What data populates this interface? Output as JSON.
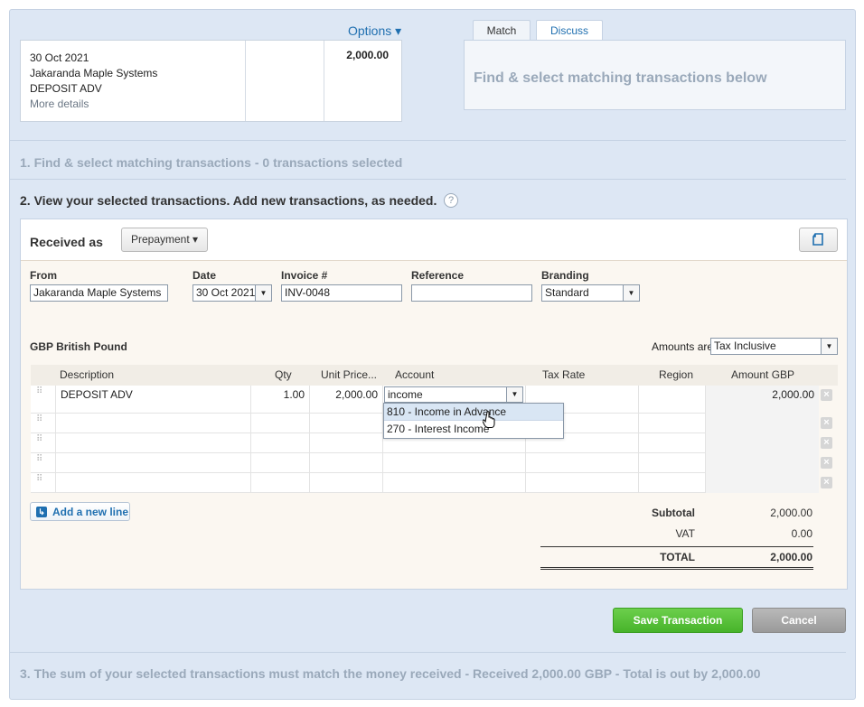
{
  "statement": {
    "date": "30 Oct 2021",
    "payee": "Jakaranda Maple Systems",
    "description": "DEPOSIT ADV",
    "more_details": "More details",
    "amount": "2,000.00",
    "options_label": "Options ▾"
  },
  "tabs": {
    "match": "Match",
    "discuss": "Discuss"
  },
  "match_panel_text": "Find & select matching transactions below",
  "steps": {
    "step1": "1. Find & select matching transactions - 0 transactions selected",
    "step2": "2. View your selected transactions. Add new transactions, as needed.",
    "step2_help": "?",
    "step3": "3. The sum of your selected transactions must match the money received - Received 2,000.00 GBP - Total is out by 2,000.00"
  },
  "form": {
    "received_as": "Received as",
    "type_button": "Prepayment ▾",
    "from_label": "From",
    "from_value": "Jakaranda Maple Systems",
    "date_label": "Date",
    "date_value": "30 Oct 2021",
    "invoice_label": "Invoice #",
    "invoice_value": "INV-0048",
    "reference_label": "Reference",
    "reference_value": "",
    "branding_label": "Branding",
    "branding_value": "Standard",
    "currency": "GBP British Pound",
    "amounts_are_label": "Amounts are",
    "amounts_are_value": "Tax Inclusive"
  },
  "table": {
    "headers": [
      "Description",
      "Qty",
      "Unit Price...",
      "Account",
      "Tax Rate",
      "Region",
      "Amount GBP"
    ],
    "row1": {
      "description": "DEPOSIT ADV",
      "qty": "1.00",
      "unit_price": "2,000.00",
      "account": "income",
      "amount": "2,000.00"
    }
  },
  "account_dropdown": [
    "810 - Income in Advance",
    "270 - Interest Income"
  ],
  "add_line": "Add a new line",
  "totals": {
    "subtotal_label": "Subtotal",
    "subtotal": "2,000.00",
    "vat_label": "VAT",
    "vat": "0.00",
    "total_label": "TOTAL",
    "total": "2,000.00"
  },
  "buttons": {
    "save": "Save Transaction",
    "cancel": "Cancel"
  },
  "colors": {
    "accent_link": "#1f6fb0",
    "save_green": "#47b32a",
    "background_blue": "#dde7f4"
  }
}
